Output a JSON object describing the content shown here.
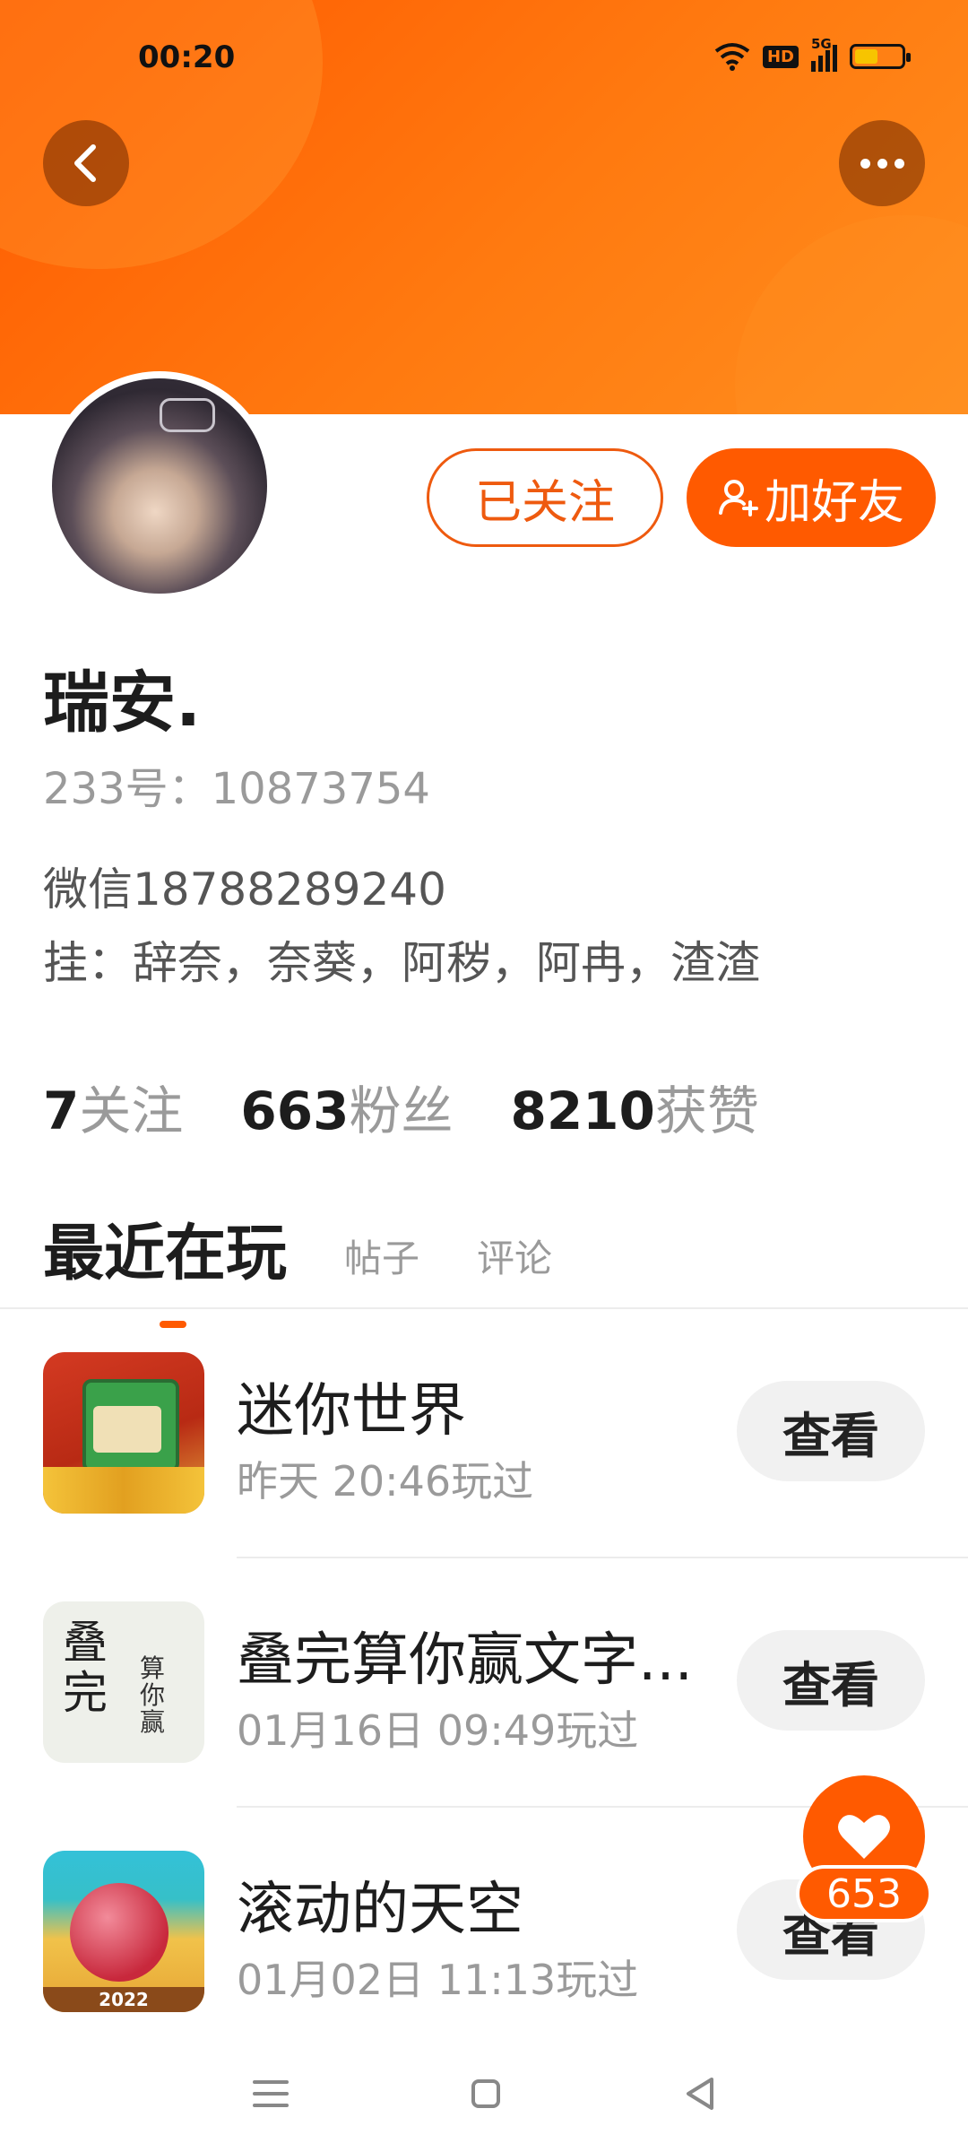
{
  "status_bar": {
    "time": "00:20",
    "hd": "HD",
    "network": "5G",
    "battery_level": 0.45
  },
  "colors": {
    "accent": "#ff5a00",
    "header_gradient_start": "#ff5a00",
    "header_gradient_end": "#ff8e1e"
  },
  "profile": {
    "name": "瑞安.",
    "id_line": "233号：10873754",
    "bio_line1": "微信18788289240",
    "bio_line2": "挂：辞奈，奈葵，阿秽，阿冉，渣渣",
    "followed_label": "已关注",
    "add_friend_label": "加好友"
  },
  "stats": [
    {
      "value": "7",
      "label": "关注"
    },
    {
      "value": "663",
      "label": "粉丝"
    },
    {
      "value": "8210",
      "label": "获赞"
    }
  ],
  "tabs": {
    "active": "最近在玩",
    "posts": "帖子",
    "comments": "评论"
  },
  "games": [
    {
      "name": "迷你世界",
      "time": "昨天 20:46玩过",
      "view_label": "查看"
    },
    {
      "name": "叠完算你赢文字...",
      "time": "01月16日 09:49玩过",
      "view_label": "查看",
      "icon_text_big": "叠完",
      "icon_text_small": "算你赢"
    },
    {
      "name": "滚动的天空",
      "time": "01月02日 11:13玩过",
      "view_label": "查看",
      "icon_year": "2022"
    }
  ],
  "like": {
    "count": "653"
  },
  "icons": {
    "back": "back-arrow-icon",
    "more": "more-dots-icon",
    "add_friend": "add-person-icon",
    "like": "heart-icon"
  }
}
